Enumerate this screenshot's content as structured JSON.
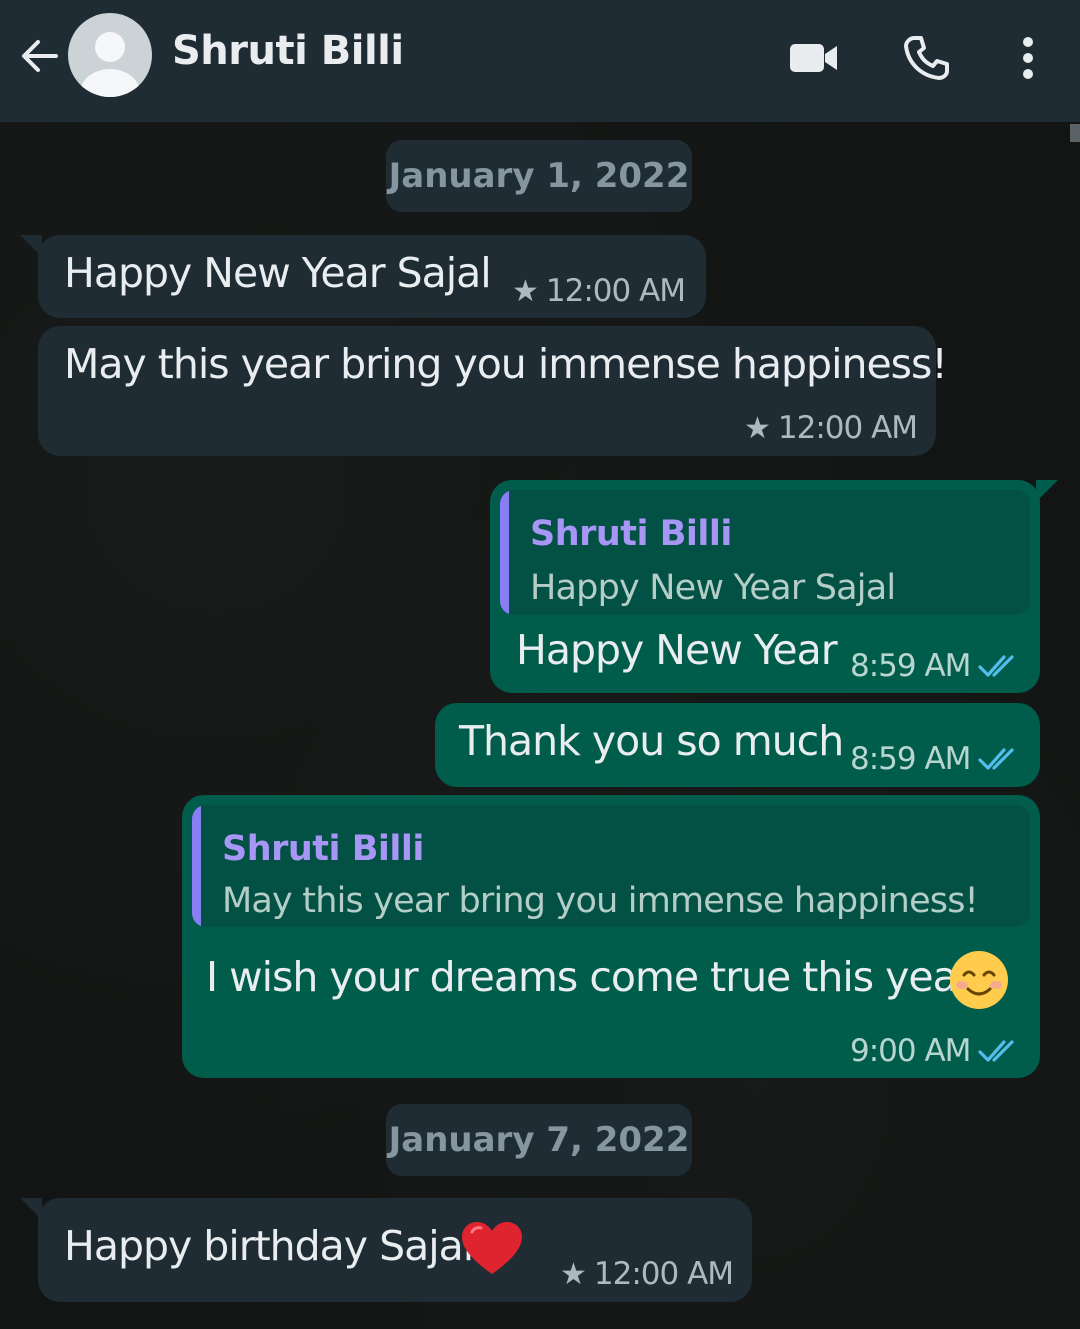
{
  "header": {
    "contact_name": "Shruti Billi",
    "icons": [
      "back-arrow-icon",
      "avatar-icon",
      "video-call-icon",
      "phone-icon",
      "more-options-icon"
    ]
  },
  "colors": {
    "header_bg": "#1f2c34",
    "incoming_bubble": "#1f2c34",
    "outgoing_bubble": "#005c4b",
    "quote_accent": "#8a7ef5",
    "read_ticks": "#53bdeb"
  },
  "messages": {
    "date1": "January 1, 2022",
    "m1": {
      "text": "Happy New Year Sajal",
      "time": "12:00 AM"
    },
    "m2": {
      "text": "May this year bring you immense happiness!",
      "time": "12:00 AM"
    },
    "m3": {
      "quote_name": "Shruti Billi",
      "quote_text": "Happy New Year Sajal",
      "text": "Happy New Year",
      "time": "8:59 AM"
    },
    "m4": {
      "text": "Thank you so much",
      "time": "8:59 AM"
    },
    "m5": {
      "quote_name": "Shruti Billi",
      "quote_text": "May this year bring you immense happiness!",
      "text": "I wish your dreams come true this year",
      "emoji": "smiling-face-icon",
      "time": "9:00 AM"
    },
    "date2": "January 7, 2022",
    "m6": {
      "text": "Happy birthday Sajal",
      "emoji": "red-heart-icon",
      "time": "12:00 AM"
    }
  }
}
